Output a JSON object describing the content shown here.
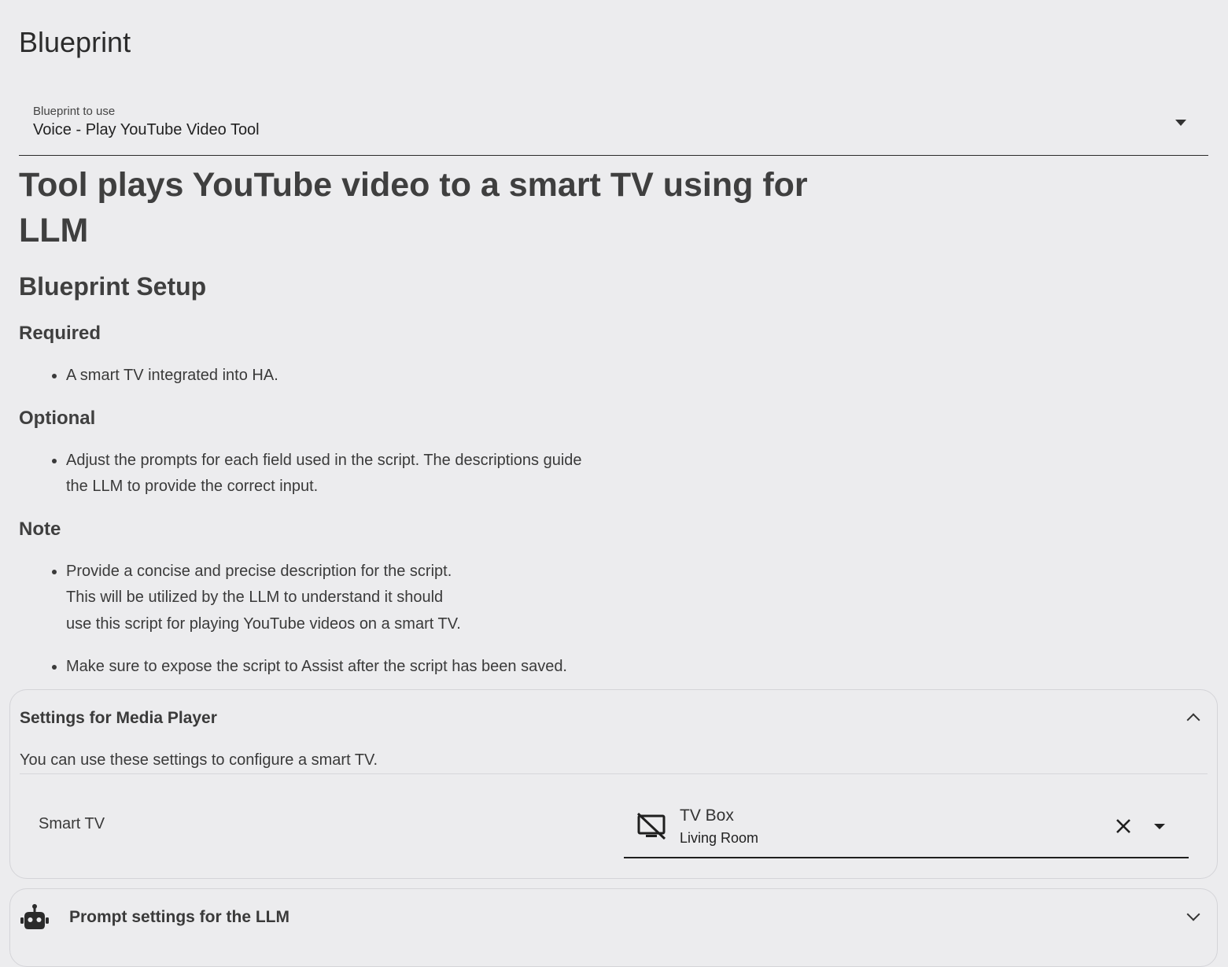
{
  "section": {
    "title": "Blueprint"
  },
  "blueprint_select": {
    "label": "Blueprint to use",
    "value": "Voice - Play YouTube Video Tool"
  },
  "description": {
    "heading": "Tool plays YouTube video to a smart TV using for LLM",
    "setup_heading": "Blueprint Setup",
    "required_heading": "Required",
    "required_items": [
      "A smart TV integrated into HA."
    ],
    "optional_heading": "Optional",
    "optional_items": [
      "Adjust the prompts for each field used in the script. The descriptions guide\nthe LLM to provide the correct input."
    ],
    "note_heading": "Note",
    "note_items": [
      "Provide a concise and precise description for the script.\nThis will be utilized by the LLM to understand it should\nuse this script for playing YouTube videos on a smart TV.",
      "Make sure to expose the script to Assist after the script has been saved."
    ]
  },
  "media_panel": {
    "title": "Settings for Media Player",
    "subtitle": "You can use these settings to configure a smart TV.",
    "expanded": true,
    "field_label": "Smart TV",
    "entity": {
      "name": "TV Box",
      "area": "Living Room",
      "icon": "television-off-icon"
    }
  },
  "llm_panel": {
    "title": "Prompt settings for the LLM",
    "icon": "robot-icon",
    "expanded": false
  }
}
